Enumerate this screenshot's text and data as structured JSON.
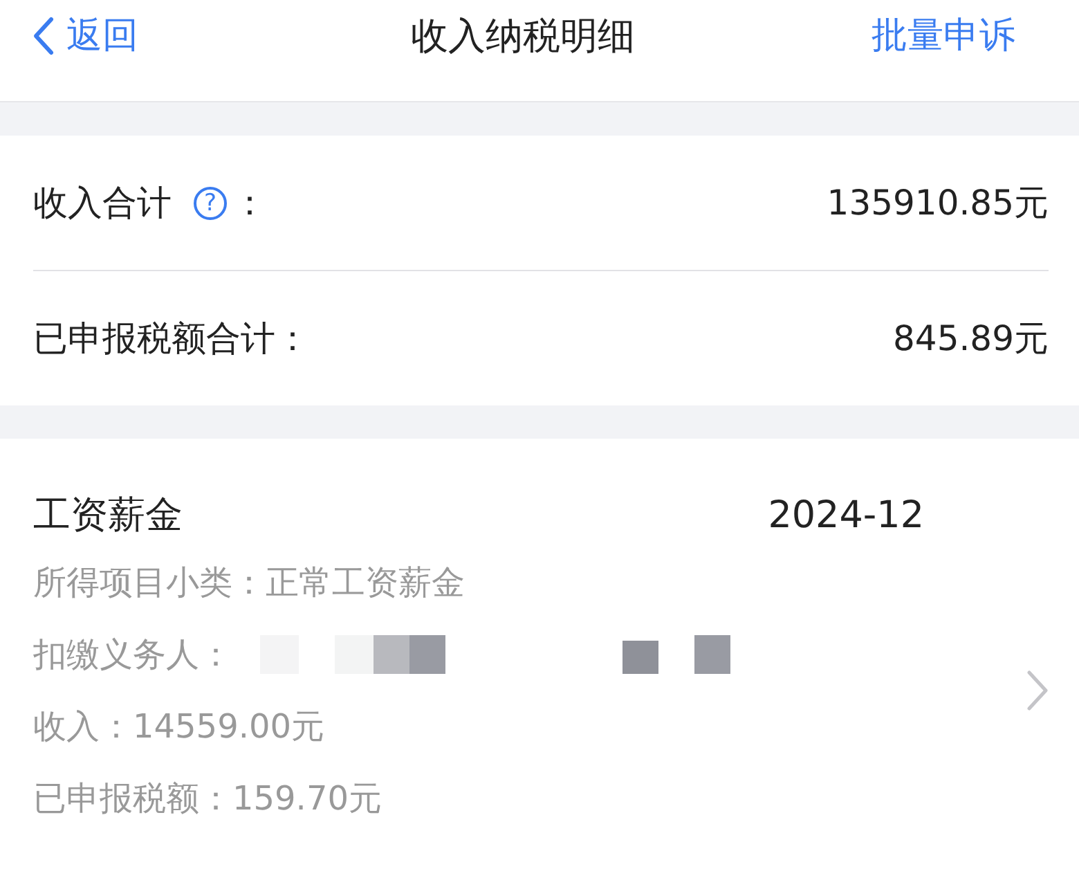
{
  "header": {
    "back_label": "返回",
    "title": "收入纳税明细",
    "action": "批量申诉"
  },
  "summary": [
    {
      "label": "收入合计",
      "help": "?",
      "colon": "：",
      "value": "135910.85元"
    },
    {
      "label": "已申报税额合计：",
      "value": "845.89元"
    }
  ],
  "records": [
    {
      "category": "工资薪金",
      "period": "2024-12",
      "details": [
        {
          "kind": "text",
          "text": "所得项目小类：正常工资薪金"
        },
        {
          "kind": "redacted",
          "text": "扣缴义务人："
        },
        {
          "kind": "text",
          "text": "收入：14559.00元"
        },
        {
          "kind": "text",
          "text": "已申报税额：159.70元"
        }
      ]
    }
  ]
}
